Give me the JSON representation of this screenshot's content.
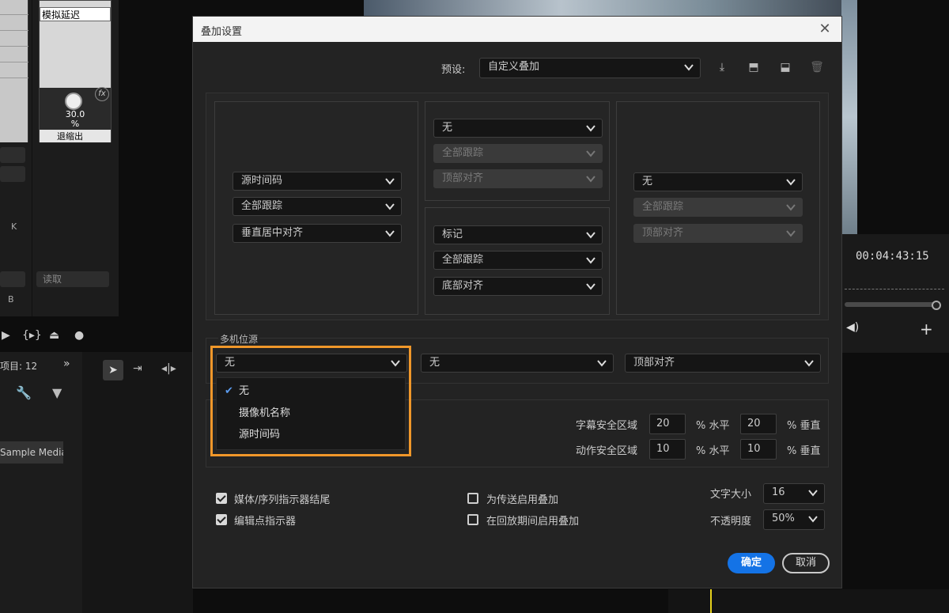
{
  "background": {
    "effect_name": "模拟延迟",
    "knob_value": "30.0",
    "knob_unit": "%",
    "effect_select": "退缩出",
    "side_letter_k": "K",
    "side_letter_b": "B",
    "read_select": "读取",
    "timecode": "00:04:43:15",
    "project_title": "项目: 12",
    "project_item": "Sample Media"
  },
  "dialog": {
    "title": "叠加设置",
    "preset_label": "预设:",
    "preset_value": "自定义叠加",
    "overlay": {
      "left": {
        "source": "源时间码",
        "tracking": "全部跟踪",
        "align": "垂直居中对齐"
      },
      "top": {
        "source": "无",
        "tracking": "全部跟踪",
        "align": "顶部对齐"
      },
      "bottom": {
        "source": "标记",
        "tracking": "全部跟踪",
        "align": "底部对齐"
      },
      "right": {
        "source": "无",
        "tracking": "全部跟踪",
        "align": "顶部对齐"
      }
    },
    "multicam": {
      "label": "多机位源",
      "source_value": "无",
      "second_value": "无",
      "align_value": "顶部对齐",
      "menu": [
        {
          "label": "无",
          "checked": true
        },
        {
          "label": "摄像机名称",
          "checked": false
        },
        {
          "label": "源时间码",
          "checked": false
        }
      ]
    },
    "safe": {
      "title_label": "字幕安全区域",
      "title_h": "20",
      "title_v": "20",
      "action_label": "动作安全区域",
      "action_h": "10",
      "action_v": "10",
      "pct_h": "% 水平",
      "pct_v": "% 垂直"
    },
    "options": {
      "media_label": "媒体/序列指示器结尾",
      "media_checked": true,
      "edit_label": "编辑点指示器",
      "edit_checked": true,
      "transmit_label": "为传送启用叠加",
      "transmit_checked": false,
      "playback_label": "在回放期间启用叠加",
      "playback_checked": false
    },
    "text_size_label": "文字大小",
    "text_size_value": "16",
    "opacity_label": "不透明度",
    "opacity_value": "50%",
    "ok_label": "确定",
    "cancel_label": "取消"
  },
  "colors": {
    "accent": "#1473e6",
    "highlight": "#f0972a",
    "check": "#5b9cf0"
  }
}
